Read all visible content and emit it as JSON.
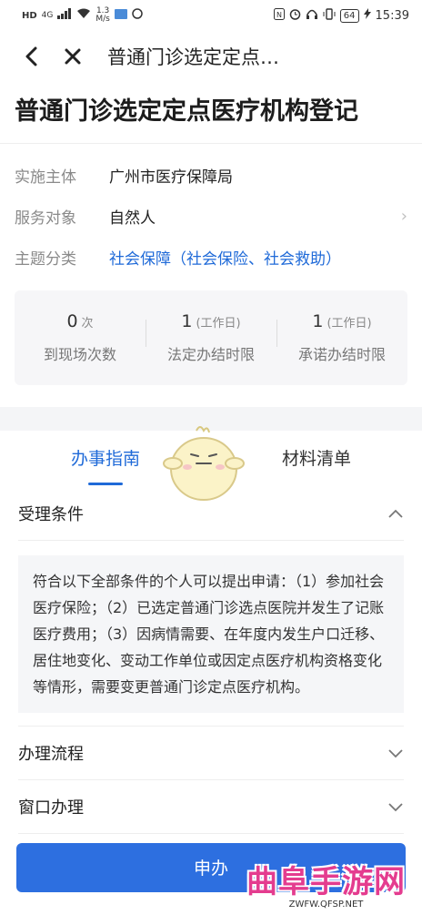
{
  "status_bar": {
    "network": "HD",
    "signal": "4G",
    "speed_value": "1.3",
    "speed_unit": "M/s",
    "battery": "64",
    "time": "15:39"
  },
  "nav": {
    "title": "普通门诊选定定点…"
  },
  "page": {
    "title": "普通门诊选定定点医疗机构登记"
  },
  "info": [
    {
      "label": "实施主体",
      "value": "广州市医疗保障局"
    },
    {
      "label": "服务对象",
      "value": "自然人"
    },
    {
      "label": "主题分类",
      "value": "社会保障（社会保险、社会救助）"
    }
  ],
  "stats": [
    {
      "num": "0",
      "unit": "次",
      "label": "到现场次数"
    },
    {
      "num": "1",
      "unit": "(工作日)",
      "label": "法定办结时限"
    },
    {
      "num": "1",
      "unit": "(工作日)",
      "label": "承诺办结时限"
    }
  ],
  "tabs": [
    {
      "label": "办事指南"
    },
    {
      "label": "材料清单"
    }
  ],
  "sections": [
    {
      "title": "受理条件",
      "body": "符合以下全部条件的个人可以提出申请：（1）参加社会医疗保险；（2）已选定普通门诊选点医院并发生了记账医疗费用；（3）因病情需要、在年度内发生户口迁移、居住地变化、变动工作单位或因定点医疗机构资格变化等情形，需要变更普通门诊定点医疗机构。"
    },
    {
      "title": "办理流程"
    },
    {
      "title": "窗口办理"
    }
  ],
  "apply": {
    "label": "申办"
  },
  "watermark": {
    "text": "曲阜手游网",
    "url": "ZWFW.QFSP.NET"
  }
}
